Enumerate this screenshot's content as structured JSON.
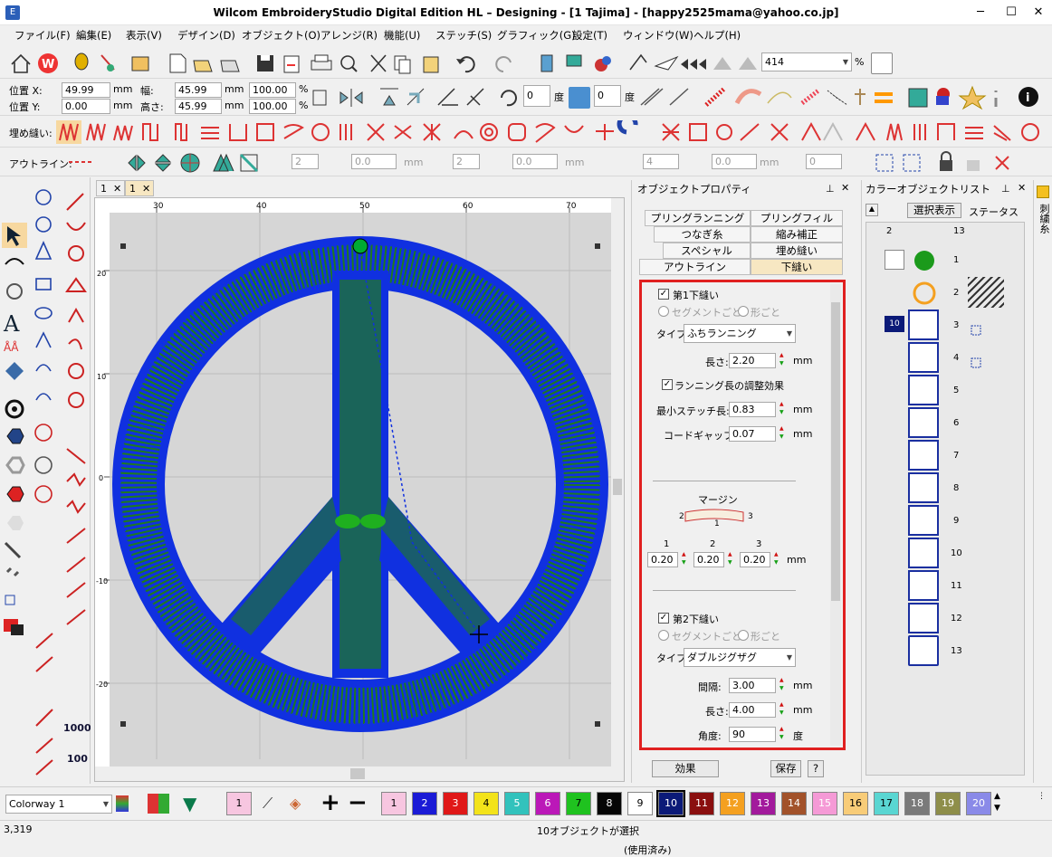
{
  "window": {
    "title": "Wilcom EmbroideryStudio Digital Edition HL – Designing - [1      Tajima] - [happy2525mama@yahoo.co.jp]",
    "minimize": "─",
    "maximize": "☐",
    "close": "✕"
  },
  "menu": [
    "ファイル(F)",
    "編集(E)",
    "表示(V)",
    "デザイン(D)",
    "オブジェクト(O)",
    "アレンジ(R)",
    "機能(U)",
    "ステッチ(S)",
    "グラフィック(G)",
    "設定(T)",
    "ウィンドウ(W)",
    "ヘルプ(H)"
  ],
  "toolbar1": {
    "zoom_value": "414",
    "zoom_unit": "%"
  },
  "toolbar2": {
    "pos_x_label": "位置 X:",
    "pos_x": "49.99",
    "pos_y_label": "位置 Y:",
    "pos_y": "0.00",
    "unit": "mm",
    "width_label": "幅:",
    "width": "45.99",
    "height_label": "高さ:",
    "height": "45.99",
    "scale_w": "100.00",
    "scale_h": "100.00",
    "percent": "%",
    "rot_angle": "0",
    "slant_angle": "0",
    "deg": "度"
  },
  "toolbar3": {
    "fill_label": "埋め縫い:"
  },
  "toolbar4": {
    "outline_label": "アウトライン:",
    "v1": "2",
    "v2": "0.0",
    "v3": "2",
    "v4": "0.0",
    "v5": "4",
    "v6": "0.0",
    "v7": "0",
    "mm": "mm"
  },
  "doc_tabs": [
    {
      "label": "1",
      "close": "✕"
    },
    {
      "label": "1",
      "close": "✕"
    }
  ],
  "ruler": {
    "top_ticks": [
      "30",
      "40",
      "50",
      "60",
      "70"
    ],
    "left_ticks": [
      "20",
      "10",
      "0",
      "-10",
      "-20"
    ]
  },
  "object_properties": {
    "title": "オブジェクトプロパティ",
    "tabs_row1": [
      "プリングランニング",
      "プリングフィル"
    ],
    "tabs_row2": [
      "つなぎ糸",
      "縮み補正"
    ],
    "tabs_row3": [
      "スペシャル",
      "埋め縫い"
    ],
    "tabs_row4": [
      "アウトライン",
      "下縫い"
    ],
    "first_underlay": {
      "label": "第1下縫い",
      "checked": true,
      "opt_segment": "セグメントごと",
      "opt_shape": "形ごと",
      "type_label": "タイプ:",
      "type_value": "ふちランニング",
      "length_label": "長さ:",
      "length": "2.20",
      "adjust_label": "ランニング長の調整効果",
      "adjust_checked": true,
      "min_stitch_label": "最小ステッチ長:",
      "min_stitch": "0.83",
      "chord_gap_label": "コードギャップ:",
      "chord_gap": "0.07",
      "unit": "mm"
    },
    "margin": {
      "label": "マージン",
      "pts": [
        "2",
        "1",
        "3"
      ],
      "col_labels": [
        "1",
        "2",
        "3"
      ],
      "values": [
        "0.20",
        "0.20",
        "0.20"
      ],
      "unit": "mm"
    },
    "second_underlay": {
      "label": "第2下縫い",
      "checked": true,
      "opt_segment": "セグメントごと",
      "opt_shape": "形ごと",
      "type_label": "タイプ:",
      "type_value": "ダブルジグザグ",
      "spacing_label": "間隔:",
      "spacing": "3.00",
      "length_label": "長さ:",
      "length": "4.00",
      "angle_label": "角度:",
      "angle": "90",
      "unit": "mm",
      "deg": "度"
    },
    "effects_button": "効果",
    "save_button": "保存",
    "help_button": "?"
  },
  "color_object_list": {
    "title": "カラーオブジェクトリスト",
    "show_selected": "選択表示",
    "status_label": "ステータス",
    "col_headers": [
      "2",
      "13"
    ],
    "group_label": "10",
    "rows": [
      "1",
      "2",
      "3",
      "4",
      "5",
      "6",
      "7",
      "8",
      "9",
      "10",
      "11",
      "12",
      "13"
    ]
  },
  "dock_tab": "刺繍糸",
  "palette": {
    "colorway": "Colorway 1",
    "current": "1",
    "swatches": [
      {
        "n": "1",
        "c": "#f7c6e0",
        "t": "#000"
      },
      {
        "n": "2",
        "c": "#1b1bd6",
        "t": "#fff"
      },
      {
        "n": "3",
        "c": "#e01818",
        "t": "#fff"
      },
      {
        "n": "4",
        "c": "#f3e31a",
        "t": "#000"
      },
      {
        "n": "5",
        "c": "#32c2bc",
        "t": "#fff"
      },
      {
        "n": "6",
        "c": "#bb18b8",
        "t": "#fff"
      },
      {
        "n": "7",
        "c": "#1fc21f",
        "t": "#000"
      },
      {
        "n": "8",
        "c": "#050505",
        "t": "#fff"
      },
      {
        "n": "9",
        "c": "#ffffff",
        "t": "#000"
      },
      {
        "n": "10",
        "c": "#0b1a78",
        "t": "#fff"
      },
      {
        "n": "11",
        "c": "#8a0f0f",
        "t": "#fff"
      },
      {
        "n": "12",
        "c": "#f4a020",
        "t": "#fff"
      },
      {
        "n": "13",
        "c": "#a21a9c",
        "t": "#fff"
      },
      {
        "n": "14",
        "c": "#a2522a",
        "t": "#fff"
      },
      {
        "n": "15",
        "c": "#f59ad6",
        "t": "#fff"
      },
      {
        "n": "16",
        "c": "#f8cc78",
        "t": "#000"
      },
      {
        "n": "17",
        "c": "#5ad6d2",
        "t": "#000"
      },
      {
        "n": "18",
        "c": "#7a7a7a",
        "t": "#fff"
      },
      {
        "n": "19",
        "c": "#8e8e4a",
        "t": "#fff"
      },
      {
        "n": "20",
        "c": "#8a8ae8",
        "t": "#fff"
      }
    ]
  },
  "status": {
    "count": "3,319",
    "message": "10オブジェクトが選択",
    "usage": "(使用済み)"
  },
  "colors": {
    "accent_red": "#e02020",
    "design_blue": "#1030e0",
    "design_green": "#1f7a1f"
  }
}
